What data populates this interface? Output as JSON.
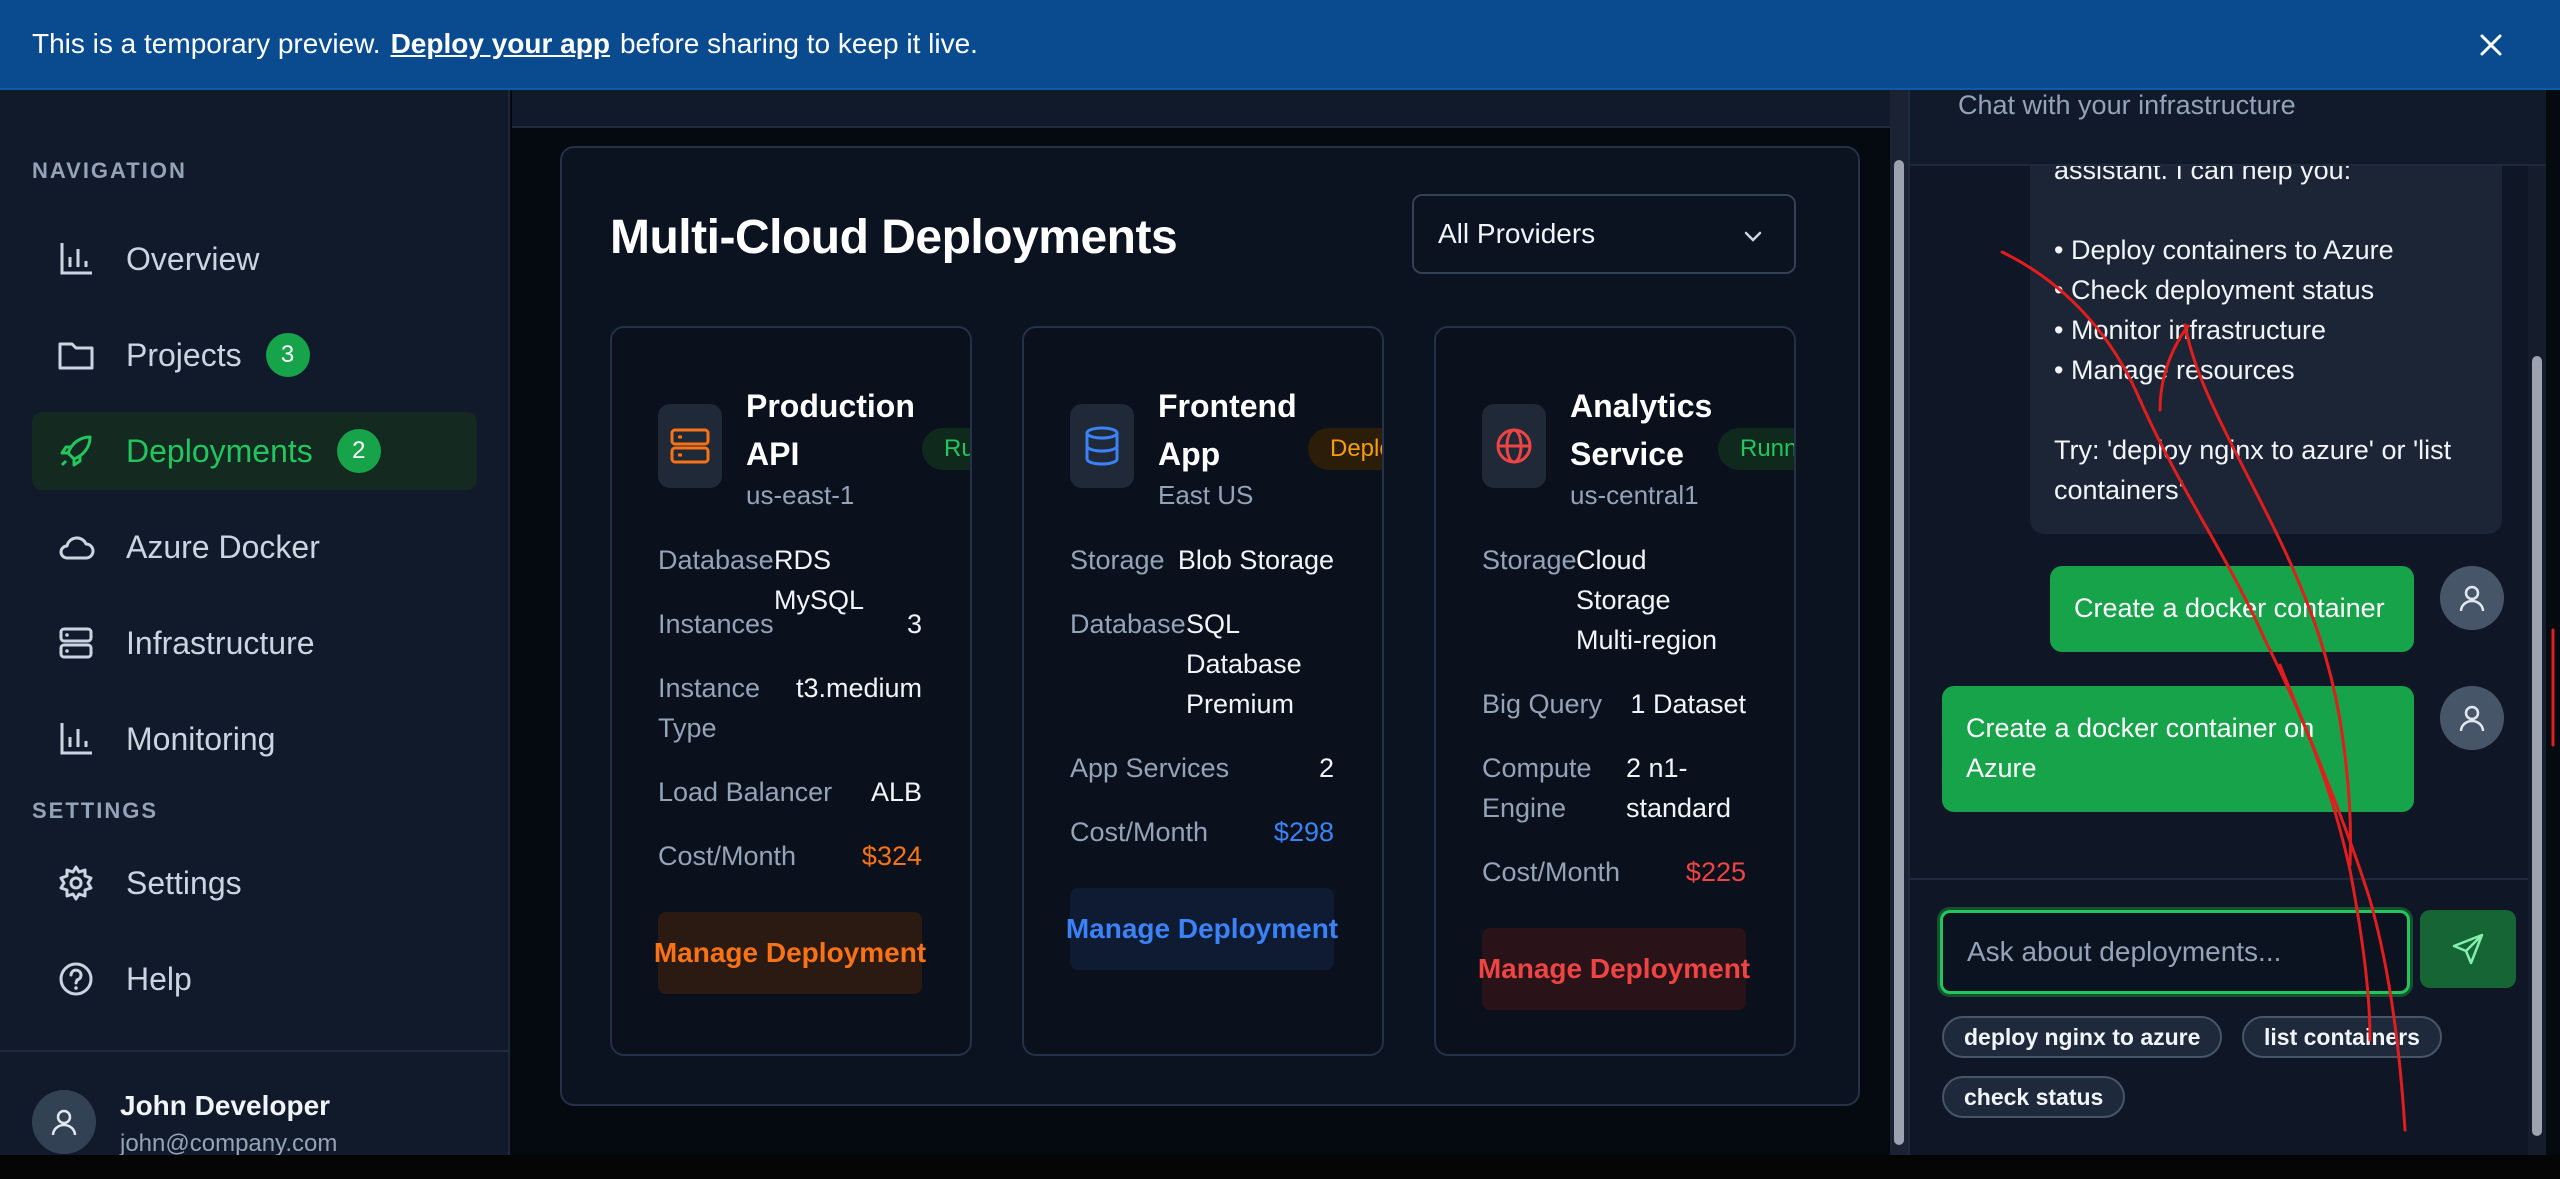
{
  "banner": {
    "text_before": "This is a temporary preview.",
    "link": "Deploy your app",
    "text_after": "before sharing to keep it live."
  },
  "sidebar": {
    "nav_heading": "NAVIGATION",
    "settings_heading": "SETTINGS",
    "nav_items": [
      {
        "label": "Overview",
        "icon": "bar-chart-icon"
      },
      {
        "label": "Projects",
        "icon": "folder-icon",
        "badge": "3"
      },
      {
        "label": "Deployments",
        "icon": "rocket-icon",
        "badge": "2",
        "active": true
      },
      {
        "label": "Azure Docker",
        "icon": "cloud-icon"
      },
      {
        "label": "Infrastructure",
        "icon": "server-icon"
      },
      {
        "label": "Monitoring",
        "icon": "bar-chart-icon"
      }
    ],
    "settings_items": [
      {
        "label": "Settings",
        "icon": "gear-icon"
      },
      {
        "label": "Help",
        "icon": "help-circle-icon"
      }
    ],
    "user": {
      "name": "John Developer",
      "email": "john@company.com"
    }
  },
  "main": {
    "title": "Multi-Cloud Deployments",
    "provider_filter": "All Providers",
    "cards": [
      {
        "title": "Production API",
        "region": "us-east-1",
        "status": "Running",
        "specs": [
          {
            "key": "Database",
            "value": "RDS MySQL"
          },
          {
            "key": "Instances",
            "value": "3"
          },
          {
            "key": "Instance Type",
            "value": "t3.medium"
          },
          {
            "key": "Load Balancer",
            "value": "ALB"
          },
          {
            "key": "Cost/Month",
            "value": "$324"
          }
        ],
        "action": "Manage Deployment",
        "accent": "#f97316"
      },
      {
        "title": "Frontend App",
        "region": "East US",
        "status": "Deploying",
        "specs": [
          {
            "key": "Storage",
            "value": "Blob Storage"
          },
          {
            "key": "Database",
            "value": "SQL Database Premium"
          },
          {
            "key": "App Services",
            "value": "2"
          },
          {
            "key": "Cost/Month",
            "value": "$298"
          }
        ],
        "action": "Manage Deployment",
        "accent": "#3b82f6"
      },
      {
        "title": "Analytics Service",
        "region": "us-central1",
        "status": "Running",
        "specs": [
          {
            "key": "Storage",
            "value": "Cloud Storage Multi-region"
          },
          {
            "key": "Big Query",
            "value": "1 Dataset"
          },
          {
            "key": "Compute Engine",
            "value": "2 n1-standard"
          },
          {
            "key": "Cost/Month",
            "value": "$225"
          }
        ],
        "action": "Manage Deployment",
        "accent": "#ef4444"
      }
    ]
  },
  "chat": {
    "subtitle": "Chat with your infrastructure",
    "bot_lines": [
      "assistant. I can help you:",
      "",
      "• Deploy containers to Azure",
      "• Check deployment status",
      "• Monitor infrastructure",
      "• Manage resources",
      "",
      "Try: 'deploy nginx to azure' or 'list",
      "containers'"
    ],
    "user_messages": [
      "Create a docker container",
      "Create a docker container on Azure"
    ],
    "input_placeholder": "Ask about deployments...",
    "suggestions": [
      "deploy nginx to azure",
      "list containers",
      "check status"
    ]
  }
}
